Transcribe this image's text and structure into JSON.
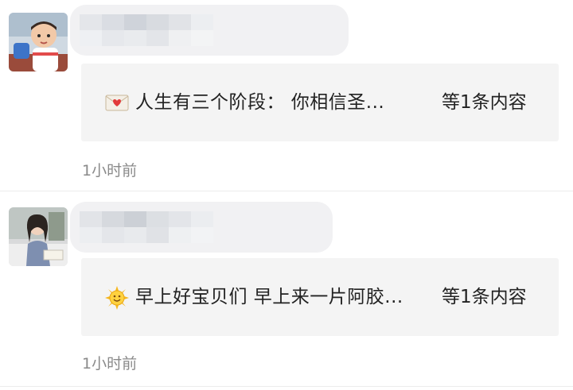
{
  "posts": [
    {
      "author_avatar": "child-avatar",
      "preview": "人生有三个阶段：  你相信圣...",
      "preview_icon": "envelope-heart-icon",
      "count": "等1条内容",
      "time": "1小时前"
    },
    {
      "author_avatar": "woman-avatar",
      "preview": "早上好宝贝们  早上来一片阿胶...",
      "preview_icon": "sun-icon",
      "count": "等1条内容",
      "time": "1小时前"
    }
  ],
  "colors": {
    "card_bg": "#f4f4f4",
    "time_text": "#8a8a8a",
    "divider": "#ececec"
  }
}
